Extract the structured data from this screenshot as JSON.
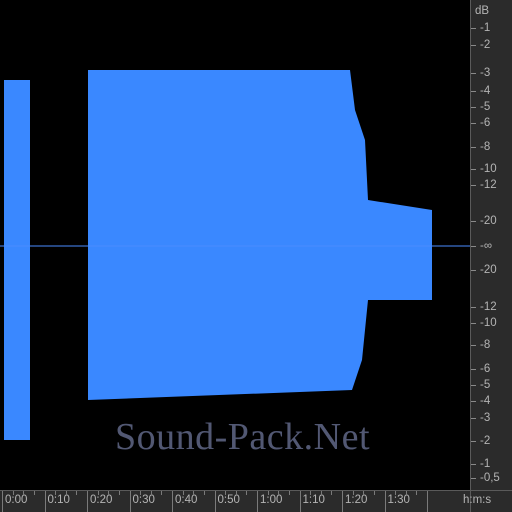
{
  "db_ruler": {
    "unit": "dB",
    "upper": [
      "-1",
      "-2",
      "-3",
      "-4",
      "-5",
      "-6",
      "-8",
      "-10",
      "-12",
      "-20"
    ],
    "center": "-∞",
    "lower": [
      "-20",
      "-12",
      "-10",
      "-8",
      "-6",
      "-5",
      "-4",
      "-3",
      "-2",
      "-1",
      "-0,5"
    ]
  },
  "time_ruler": {
    "labels": [
      "0:00",
      "0:10",
      "0:20",
      "0:30",
      "0:40",
      "0:50",
      "1:00",
      "1:10",
      "1:20",
      "1:30"
    ],
    "unit": "h:m:s"
  },
  "watermark": "Sound-Pack.Net",
  "colors": {
    "waveform": "#3a88ff",
    "background": "#000000",
    "ruler": "#2b2b2b",
    "ruler_text": "#b4b4b4",
    "center_line": "#4a8cff"
  }
}
